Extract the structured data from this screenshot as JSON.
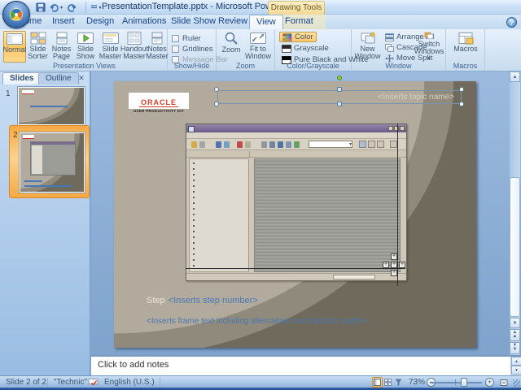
{
  "titlebar": {
    "title": "PresentationTemplate.pptx - Microsoft PowerPoint",
    "contextual_group": "Drawing Tools"
  },
  "tabs": {
    "home": "Home",
    "insert": "Insert",
    "design": "Design",
    "animations": "Animations",
    "slideshow": "Slide Show",
    "review": "Review",
    "view": "View",
    "format": "Format"
  },
  "ribbon": {
    "presentation_views": {
      "label": "Presentation Views",
      "normal": "Normal",
      "slide_sorter": "Slide Sorter",
      "notes_page": "Notes Page",
      "slide_show": "Slide Show",
      "slide_master": "Slide Master",
      "handout_master": "Handout Master",
      "notes_master": "Notes Master"
    },
    "show_hide": {
      "label": "Show/Hide",
      "ruler": "Ruler",
      "gridlines": "Gridlines",
      "message_bar": "Message Bar"
    },
    "zoom_group": {
      "label": "Zoom",
      "zoom": "Zoom",
      "fit": "Fit to Window"
    },
    "color_grayscale": {
      "label": "Color/Grayscale",
      "color": "Color",
      "grayscale": "Grayscale",
      "pure_bw": "Pure Black and White"
    },
    "window_group": {
      "label": "Window",
      "new_window": "New Window",
      "arrange_all": "Arrange All",
      "cascade": "Cascade",
      "move_split": "Move Split",
      "switch_windows": "Switch Windows"
    },
    "macros_group": {
      "label": "Macros",
      "macros": "Macros"
    }
  },
  "slides_panel": {
    "slides_tab": "Slides",
    "outline_tab": "Outline",
    "slide1_number": "1",
    "slide2_number": "2"
  },
  "slide": {
    "logo_title": "ORACLE",
    "logo_subtitle": "USER PRODUCTIVITY KIT",
    "topic_placeholder": "<Inserts topic name>",
    "step_word": "Step",
    "step_placeholder": "<Inserts step number>",
    "frame_placeholder": "<Inserts frame text including alternatives and decision paths>"
  },
  "notes": {
    "placeholder": "Click to add notes"
  },
  "statusbar": {
    "slide_indicator": "Slide 2 of 2",
    "theme": "\"Technic\"",
    "language": "English (U.S.)",
    "zoom_level": "73%"
  }
}
